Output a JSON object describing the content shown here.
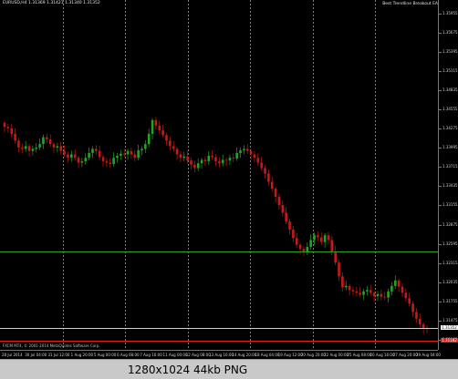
{
  "chart_header": "EURUSD,H4  1.31369 1.31421 1.31340 1.31352",
  "indicator_name": "Best Trendline Breakout EA",
  "copyright": "FXCM MT4, © 2001-2014 MetaQuotes Software Corp.",
  "price_tag_current": "1.31352",
  "price_tag_red": "1.31182",
  "status_bar": {
    "text": "1280x1024 44kb PNG"
  },
  "colors": {
    "bull": "#1fa81f",
    "bear": "#c41a1a",
    "green_line": "#2e9e2e",
    "red_line": "#e02020",
    "white_line": "#cfcfcf"
  },
  "chart_data": {
    "type": "candlestick",
    "symbol": "EURUSD",
    "timeframe": "H4",
    "ylim": [
      1.311,
      1.361
    ],
    "y_ticks": [
      "1.35955",
      "1.35675",
      "1.35395",
      "1.35115",
      "1.34835",
      "1.34555",
      "1.34275",
      "1.33995",
      "1.33715",
      "1.33435",
      "1.33155",
      "1.32875",
      "1.32595",
      "1.32315",
      "1.32035",
      "1.31755",
      "1.31475",
      "1.31195"
    ],
    "x_ticks": [
      "28 Jul 2014",
      "30 Jul 04:00",
      "31 Jul 12:00",
      "1 Aug 20:00",
      "5 Aug 00:00",
      "6 Aug 08:00",
      "7 Aug 16:00",
      "11 Aug 00:00",
      "12 Aug 08:00",
      "13 Aug 16:00",
      "14 Aug 20:00",
      "18 Aug 04:00",
      "19 Aug 12:00",
      "20 Aug 20:00",
      "22 Aug 00:00",
      "25 Aug 08:00",
      "26 Aug 16:00",
      "27 Aug 20:00",
      "29 Aug 04:00"
    ],
    "vertical_separators": 6,
    "horizontal_lines": [
      {
        "color": "green",
        "price": 1.3248
      },
      {
        "color": "white",
        "price": 1.3137
      },
      {
        "color": "red",
        "price": 1.3118
      }
    ],
    "close_path": [
      1.343,
      1.3428,
      1.342,
      1.341,
      1.34,
      1.3398,
      1.3402,
      1.3395,
      1.3398,
      1.34,
      1.3405,
      1.3415,
      1.3412,
      1.3405,
      1.34,
      1.3402,
      1.3395,
      1.339,
      1.3385,
      1.339,
      1.3385,
      1.3378,
      1.338,
      1.3385,
      1.3392,
      1.3398,
      1.3395,
      1.3386,
      1.338,
      1.3378,
      1.3376,
      1.3385,
      1.3388,
      1.3391,
      1.339,
      1.3395,
      1.339,
      1.3385,
      1.3396,
      1.3398,
      1.3405,
      1.342,
      1.344,
      1.3432,
      1.3425,
      1.3418,
      1.341,
      1.3402,
      1.3398,
      1.339,
      1.3385,
      1.3387,
      1.3381,
      1.3375,
      1.337,
      1.3377,
      1.3382,
      1.338,
      1.3388,
      1.3386,
      1.338,
      1.3377,
      1.3382,
      1.3381,
      1.3385,
      1.3384,
      1.3392,
      1.3396,
      1.3398,
      1.3395,
      1.339,
      1.3385,
      1.3378,
      1.337,
      1.3362,
      1.335,
      1.334,
      1.3328,
      1.3316,
      1.3305,
      1.3292,
      1.328,
      1.3268,
      1.3258,
      1.3252,
      1.3248,
      1.3255,
      1.3265,
      1.3272,
      1.3269,
      1.3262,
      1.3272,
      1.3265,
      1.3248,
      1.3232,
      1.3212,
      1.3196,
      1.3198,
      1.3192,
      1.319,
      1.3188,
      1.3185,
      1.319,
      1.3192,
      1.3188,
      1.3183,
      1.3186,
      1.3182,
      1.3181,
      1.319,
      1.3198,
      1.3206,
      1.3197,
      1.3188,
      1.318,
      1.3172,
      1.316,
      1.315,
      1.3142,
      1.3136,
      1.3135
    ]
  }
}
